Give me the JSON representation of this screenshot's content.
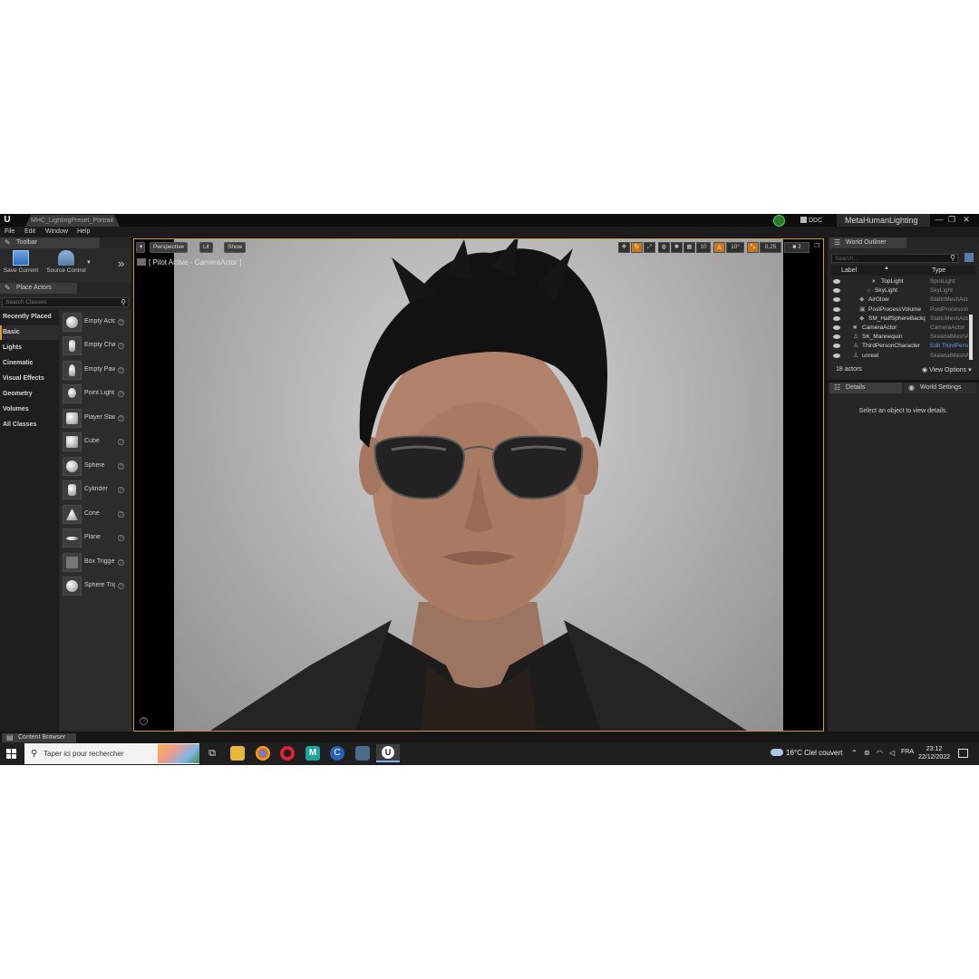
{
  "titlebar": {
    "document_tab": "MHC_LightingPreset_Portrait",
    "ddc": "DDC",
    "project": "MetaHumanLighting",
    "window_buttons": [
      "—",
      "❐",
      "✕"
    ]
  },
  "menu": [
    "File",
    "Edit",
    "Window",
    "Help"
  ],
  "toolbar": {
    "tab": "Toolbar",
    "save": "Save Current",
    "source_control": "Source Control"
  },
  "place_actors": {
    "tab": "Place Actors",
    "search_placeholder": "Search Classes",
    "categories": [
      "Recently Placed",
      "Basic",
      "Lights",
      "Cinematic",
      "Visual Effects",
      "Geometry",
      "Volumes",
      "All Classes"
    ],
    "active_category": "Basic",
    "items": [
      "Empty Actor",
      "Empty Character",
      "Empty Pawn",
      "Point Light",
      "Player Start",
      "Cube",
      "Sphere",
      "Cylinder",
      "Cone",
      "Plane",
      "Box Trigger",
      "Sphere Trigger"
    ]
  },
  "viewport": {
    "perspective": "Perspective",
    "lit": "Lit",
    "show": "Show",
    "pilot_text": "[ Pilot Active - CameraActor ]",
    "grid_snap": "10",
    "rot_snap": "10°",
    "scale_snap": "0,25",
    "camera_speed": "2"
  },
  "world_outliner": {
    "tab": "World Outliner",
    "search_placeholder": "Search...",
    "col_label": "Label",
    "col_type": "Type",
    "rows": [
      {
        "label": "TopLight",
        "type": "SpotLight",
        "indent": 3,
        "icon": "spotlight-icon"
      },
      {
        "label": "SkyLight",
        "type": "SkyLight",
        "indent": 2,
        "icon": "skylight-icon"
      },
      {
        "label": "AirGlow",
        "type": "StaticMeshActor",
        "indent": 1,
        "icon": "mesh-icon"
      },
      {
        "label": "PostProcessVolume",
        "type": "PostProcessVolume",
        "indent": 1,
        "icon": "volume-icon"
      },
      {
        "label": "SM_HalfSphereBackground",
        "type": "StaticMeshActor",
        "indent": 1,
        "icon": "mesh-icon"
      },
      {
        "label": "CameraActor",
        "type": "CameraActor",
        "indent": 0,
        "icon": "camera-icon"
      },
      {
        "label": "SK_Mannequin",
        "type": "SkeletalMeshActor",
        "indent": 0,
        "icon": "skeletal-icon"
      },
      {
        "label": "ThirdPersonCharacter",
        "type": "Edit ThirdPersonCharacter",
        "indent": 0,
        "icon": "character-icon",
        "link": true
      },
      {
        "label": "unreal",
        "type": "SkeletalMeshActor",
        "indent": 0,
        "icon": "skeletal-icon"
      }
    ],
    "count": "18 actors",
    "view_options": "View Options"
  },
  "details": {
    "tab": "Details",
    "world_settings_tab": "World Settings",
    "empty_message": "Select an object to view details."
  },
  "content_browser": {
    "tab": "Content Browser"
  },
  "taskbar": {
    "search_placeholder": "Taper ici pour rechercher",
    "weather": "16°C  Ciel couvert",
    "language": "FRA",
    "time": "23:12",
    "date": "22/12/2022"
  },
  "colors": {
    "accent": "#c69f3a",
    "active_category": "#d6a030",
    "link": "#5aa0f0"
  }
}
